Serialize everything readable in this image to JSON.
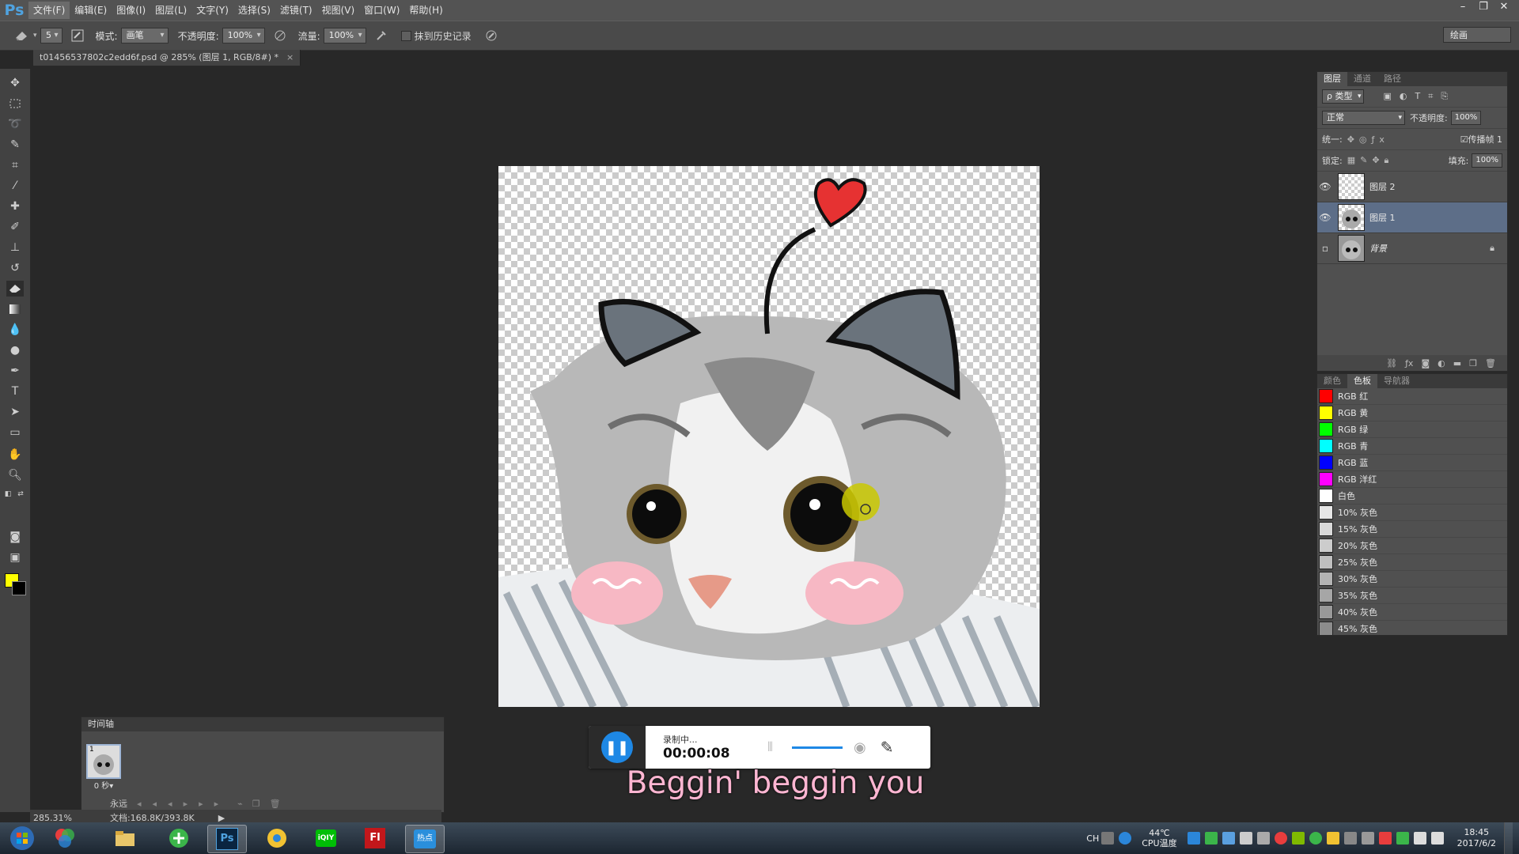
{
  "app": {
    "logo": "Ps"
  },
  "menu": [
    "文件(F)",
    "编辑(E)",
    "图像(I)",
    "图层(L)",
    "文字(Y)",
    "选择(S)",
    "滤镜(T)",
    "视图(V)",
    "窗口(W)",
    "帮助(H)"
  ],
  "window_controls": {
    "min": "–",
    "max": "❐",
    "close": "✕"
  },
  "options": {
    "brush_size": "5",
    "mode_label": "模式:",
    "mode_value": "画笔",
    "opacity_label": "不透明度:",
    "opacity_value": "100%",
    "flow_label": "流量:",
    "flow_value": "100%",
    "history_label": "抹到历史记录",
    "workspace": "绘画"
  },
  "document_tab": {
    "title": "t01456537802c2edd6f.psd @ 285% (图层 1, RGB/8#) *",
    "close": "×"
  },
  "layers_panel": {
    "tabs": [
      "图层",
      "通道",
      "路径"
    ],
    "filter_kind": "ρ 类型",
    "blend_mode": "正常",
    "opacity_label": "不透明度:",
    "opacity_value": "100%",
    "unify_label": "统一:",
    "propagate_label": "传播帧 1",
    "lock_label": "锁定:",
    "fill_label": "填充:",
    "fill_value": "100%",
    "layers": [
      {
        "name": "图层 2",
        "visible": true,
        "selected": false
      },
      {
        "name": "图层 1",
        "visible": true,
        "selected": true
      },
      {
        "name": "背景",
        "visible": false,
        "selected": false,
        "locked": true
      }
    ]
  },
  "swatches_panel": {
    "tabs": [
      "颜色",
      "色板",
      "导航器"
    ],
    "swatches": [
      {
        "name": "RGB 红",
        "color": "#ff0000"
      },
      {
        "name": "RGB 黄",
        "color": "#ffff00"
      },
      {
        "name": "RGB 绿",
        "color": "#00ff00"
      },
      {
        "name": "RGB 青",
        "color": "#00ffff"
      },
      {
        "name": "RGB 蓝",
        "color": "#0000ff"
      },
      {
        "name": "RGB 洋红",
        "color": "#ff00ff"
      },
      {
        "name": "白色",
        "color": "#ffffff"
      },
      {
        "name": "10% 灰色",
        "color": "#e6e6e6"
      },
      {
        "name": "15% 灰色",
        "color": "#d9d9d9"
      },
      {
        "name": "20% 灰色",
        "color": "#cccccc"
      },
      {
        "name": "25% 灰色",
        "color": "#bfbfbf"
      },
      {
        "name": "30% 灰色",
        "color": "#b3b3b3"
      },
      {
        "name": "35% 灰色",
        "color": "#a6a6a6"
      },
      {
        "name": "40% 灰色",
        "color": "#999999"
      },
      {
        "name": "45% 灰色",
        "color": "#8c8c8c"
      }
    ]
  },
  "timeline": {
    "title": "时间轴",
    "frame_number": "1",
    "frame_delay": "0 秒▾",
    "loop": "永远"
  },
  "status": {
    "zoom": "285.31%",
    "doc_size": "文档:168.8K/393.8K"
  },
  "recorder": {
    "status": "录制中...",
    "time": "00:00:08"
  },
  "subtitle": "Beggin' beggin you",
  "taskbar": {
    "ime": "CH",
    "temp": "44℃",
    "temp_label": "CPU温度",
    "time": "18:45",
    "date": "2017/6/2"
  },
  "colors": {
    "foreground": "#ffff00",
    "background": "#000000",
    "accent": "#1e88e5"
  }
}
